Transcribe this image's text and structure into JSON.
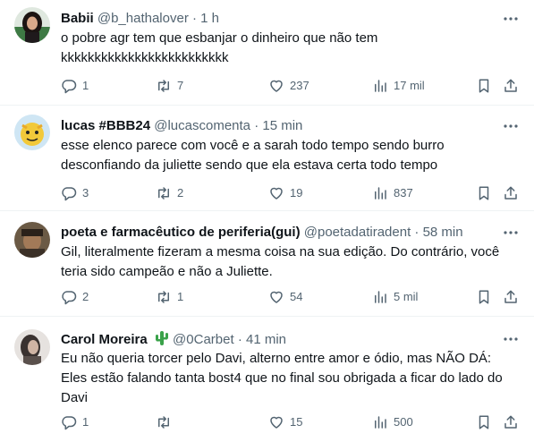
{
  "tweets": [
    {
      "name": "Babii",
      "handle": "@b_hathalover",
      "time": "1 h",
      "lines": [
        "o pobre agr tem que esbanjar o dinheiro que não tem",
        "kkkkkkkkkkkkkkkkkkkkkkkkk"
      ],
      "replies": "1",
      "retweets": "7",
      "likes": "237",
      "views": "17 mil"
    },
    {
      "name": "lucas #BBB24",
      "handle": "@lucascomenta",
      "time": "15 min",
      "lines": [
        "esse elenco parece com você e a sarah todo tempo sendo burro",
        "desconfiando da juliette sendo que ela estava certa todo tempo"
      ],
      "replies": "3",
      "retweets": "2",
      "likes": "19",
      "views": "837"
    },
    {
      "name": "poeta e farmacêutico de periferia(gui)",
      "handle": "@poetadatiradent",
      "time": "58 min",
      "lines": [
        "Gil, literalmente fizeram a mesma coisa na sua edição. Do contrário, você",
        "teria sido campeão e não a Juliette."
      ],
      "replies": "2",
      "retweets": "1",
      "likes": "54",
      "views": "5 mil"
    },
    {
      "name": "Carol Moreira",
      "handle": "@0Carbet",
      "time": "41 min",
      "lines": [
        "Eu não queria torcer pelo Davi,  alterno entre amor e ódio,  mas NÃO DÁ:",
        "Eles estão falando tanta bost4 que no final sou obrigada a ficar do lado do",
        "Davi"
      ],
      "replies": "1",
      "retweets": "",
      "likes": "15",
      "views": "500"
    }
  ],
  "separator": "·",
  "colors": {
    "text": "#0f1419",
    "secondary": "#536471",
    "border": "#eff3f4",
    "cactus": "#3aa24a"
  },
  "icons": [
    "more-icon",
    "reply-icon",
    "retweet-icon",
    "like-icon",
    "views-icon",
    "bookmark-icon",
    "share-icon",
    "cactus-icon"
  ]
}
